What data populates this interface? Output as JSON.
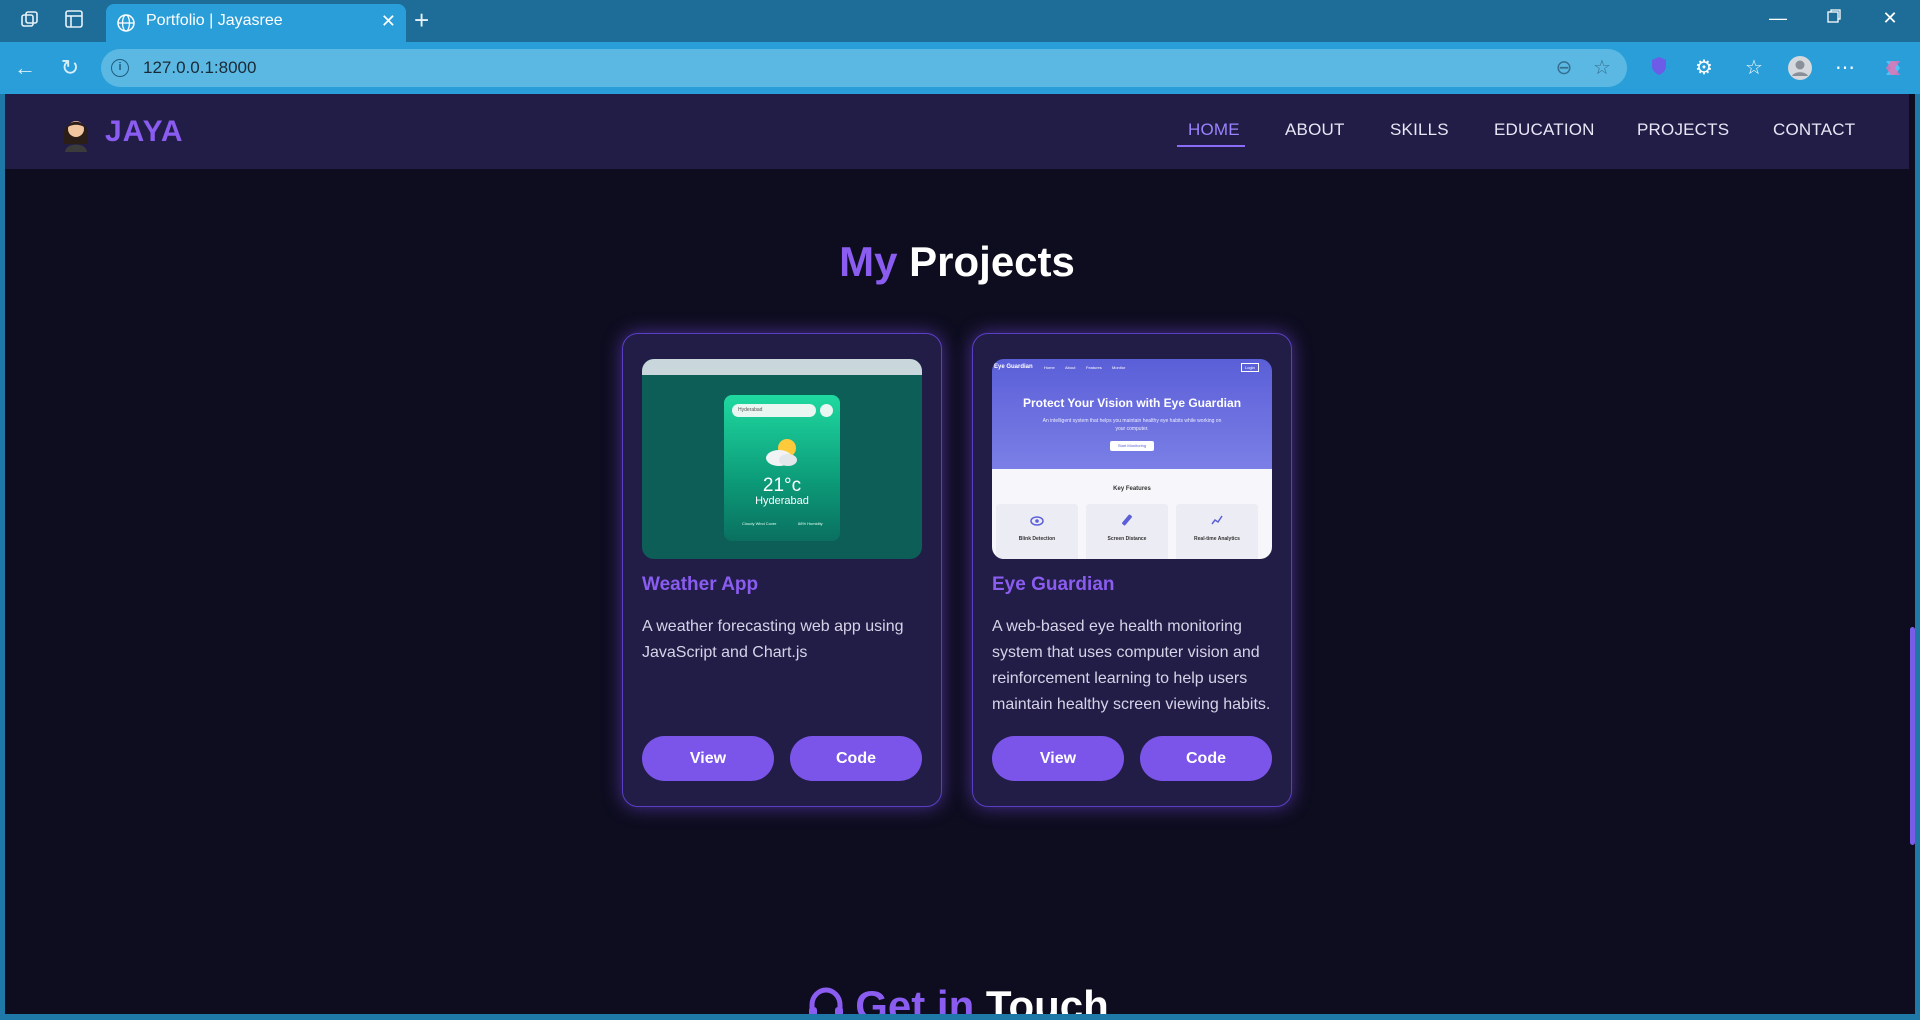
{
  "browser": {
    "tab_title": "Portfolio | Jayasree",
    "url": "127.0.0.1:8000"
  },
  "site": {
    "logo_text": "JAYA",
    "nav": [
      "HOME",
      "ABOUT",
      "SKILLS",
      "EDUCATION",
      "PROJECTS",
      "CONTACT"
    ],
    "active_nav": "HOME"
  },
  "projects_section": {
    "title_accent": "My",
    "title_rest": "Projects",
    "cards": [
      {
        "title": "Weather App",
        "description": "A weather forecasting web app using JavaScript and Chart.js",
        "view_label": "View",
        "code_label": "Code",
        "thumb": {
          "search_placeholder": "Hyderabad",
          "temperature": "21°c",
          "city": "Hyderabad",
          "meta_left": "Cloudy Wind Cover",
          "meta_right": "68% Humidity"
        }
      },
      {
        "title": "Eye Guardian",
        "description": "A web-based eye health monitoring system that uses computer vision and reinforcement learning to help users maintain healthy screen viewing habits.",
        "view_label": "View",
        "code_label": "Code",
        "thumb": {
          "brand": "Eye Guardian",
          "nav": [
            "Home",
            "About",
            "Features",
            "Monitor"
          ],
          "login": "Login",
          "headline": "Protect Your Vision with Eye Guardian",
          "subtitle": "An intelligent system that helps you maintain healthy eye habits while working on your computer.",
          "cta": "Start Monitoring",
          "features_title": "Key Features",
          "features": [
            "Blink Detection",
            "Screen Distance",
            "Real-time Analytics"
          ]
        }
      }
    ]
  },
  "contact_section": {
    "title_accent": "Get in",
    "title_rest": "Touch"
  }
}
